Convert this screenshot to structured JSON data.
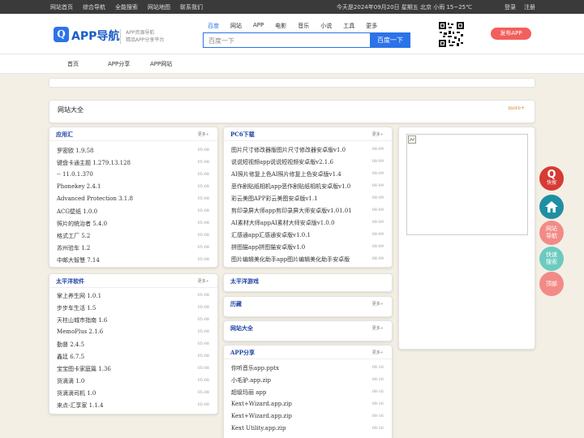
{
  "topbar": {
    "left": [
      "网站首页",
      "综合导航",
      "全能搜索",
      "网站地图",
      "联系我们"
    ],
    "info": "今天是2024年09月20日 星期五 北京 小雨 15~25℃",
    "login": "登录",
    "register": "注册"
  },
  "header": {
    "logo_icon": "Q",
    "logo": "APP导航",
    "sub1": "APP资源导航",
    "sub2": "精品APP分享平台",
    "tabs": [
      "百度",
      "网站",
      "APP",
      "电影",
      "音乐",
      "小说",
      "工具",
      "更多"
    ],
    "placeholder": "百度一下",
    "search_btn": "百度一下",
    "publish": "发布APP"
  },
  "nav": [
    "首页",
    "APP分享",
    "APP网站"
  ],
  "wzdq": {
    "title": "网站大全",
    "more": "more+"
  },
  "more": "更多+",
  "boxes": {
    "yyh": {
      "title": "应用汇",
      "items": [
        {
          "n": "罗密欧 1.9.58",
          "d": "05-08"
        },
        {
          "n": "键盘卡通主题 1.279.13.128",
          "d": "05-08"
        },
        {
          "n": "-- 11.0.1.370",
          "d": "05-08"
        },
        {
          "n": "Phonekey 2.4.1",
          "d": "05-08"
        },
        {
          "n": "Advanced Protection 3.1.8",
          "d": "05-08"
        },
        {
          "n": "ACG壁纸 1.0.0",
          "d": "05-08"
        },
        {
          "n": "照片的统治者 5.4.0",
          "d": "05-08"
        },
        {
          "n": "格式工厂 5.2",
          "d": "05-08"
        },
        {
          "n": "苏州验车 1.2",
          "d": "05-08"
        },
        {
          "n": "中邮大智慧 7.14",
          "d": "05-08"
        }
      ]
    },
    "pc6": {
      "title": "PC6下载",
      "items": [
        {
          "n": "图片尺寸修改器版图片尺寸修改器安卓版v1.0",
          "d": "08-09"
        },
        {
          "n": "说说短视频app说说短视频安卓版v2.1.6",
          "d": "08-09"
        },
        {
          "n": "AI照片修复上色AI照片修复上色安卓版v1.4",
          "d": "08-09"
        },
        {
          "n": "恶作剧贴纸相机app恶作剧贴纸相机安卓版v1.0",
          "d": "08-09"
        },
        {
          "n": "彩云美图APP彩云美图安卓版v1.1",
          "d": "08-09"
        },
        {
          "n": "剪印录屏大师app剪印录屏大师安卓版v1.01.01",
          "d": "08-09"
        },
        {
          "n": "AI素材大师appAI素材大师安卓版v1.0.0",
          "d": "08-09"
        },
        {
          "n": "汇感通app汇感通安卓版v1.0.1",
          "d": "08-09"
        },
        {
          "n": "拼图猫app拼图猫安卓版v1.0",
          "d": "08-09"
        },
        {
          "n": "图片编辑美化助手app图片编辑美化助手安卓版",
          "d": "08-09"
        }
      ]
    },
    "tpy": {
      "title": "太平洋软件",
      "items": [
        {
          "n": "掌上养生网 1.0.1",
          "d": "05-08"
        },
        {
          "n": "步步车生活 1.5",
          "d": "05-08"
        },
        {
          "n": "天柱山城市指南 1.6",
          "d": "05-08"
        },
        {
          "n": "MemoPlus 2.1.6",
          "d": "05-08"
        },
        {
          "n": "勤督 2.4.5",
          "d": "05-08"
        },
        {
          "n": "鑫廷 6.7.5",
          "d": "05-08"
        },
        {
          "n": "宝宝图卡家庭篇 1.36",
          "d": "05-08"
        },
        {
          "n": "货滴滴 1.0",
          "d": "05-08"
        },
        {
          "n": "货滴滴司机 1.0",
          "d": "05-08"
        },
        {
          "n": "来点-汇享家 1.1.4",
          "d": "05-08"
        }
      ]
    },
    "tpyyx": {
      "title": "太平洋游戏"
    },
    "ls": {
      "title": "历藏"
    },
    "wzdq2": {
      "title": "网站大全"
    },
    "appfx": {
      "title": "APP分享",
      "items": [
        {
          "n": "你听音乐app.pptx",
          "d": "08-16"
        },
        {
          "n": "小毛驴.app.zip",
          "d": "08-16"
        },
        {
          "n": "超级玛丽 app",
          "d": "08-16"
        },
        {
          "n": "Kext+Wizard.app.zip",
          "d": "08-16"
        },
        {
          "n": "Kext+Wizard.app.zip",
          "d": "08-16"
        },
        {
          "n": "Kext Utility.app.zip",
          "d": "08-16"
        }
      ]
    }
  },
  "float": {
    "kuaisou": "快搜",
    "wzdh1": "网站",
    "wzdh2": "导航",
    "kssc1": "快速",
    "kssc2": "搜索",
    "top": "顶部"
  },
  "colors": {
    "accent": "#2b73e8",
    "red": "#f25f5c",
    "teal": "#1f8fa3",
    "mint": "#6ccbc0",
    "pink": "#f28b87"
  }
}
